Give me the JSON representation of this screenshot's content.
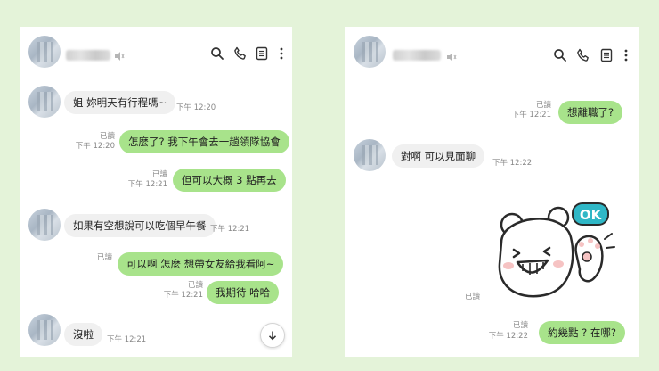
{
  "left_chat": {
    "messages": [
      {
        "text": "姐 妳明天有行程嗎~",
        "time": "下午 12:20"
      },
      {
        "text": "怎麼了? 我下午會去一趟領隊協會",
        "read": "已讀",
        "time": "下午 12:20"
      },
      {
        "text": "但可以大概 3 點再去",
        "read": "已讀",
        "time": "下午 12:21"
      },
      {
        "text": "如果有空想說可以吃個早午餐",
        "time": "下午 12:21"
      },
      {
        "text": "可以啊  怎麼  想帶女友給我看阿~",
        "read": "已讀"
      },
      {
        "text": "我期待  哈哈",
        "read": "已讀",
        "time": "下午 12:21"
      },
      {
        "text": "沒啦",
        "time": "下午 12:21"
      }
    ]
  },
  "right_chat": {
    "messages": [
      {
        "text": "想離職了?",
        "read": "已讀",
        "time": "下午 12:21"
      },
      {
        "text": "對啊 可以見面聊",
        "time": "下午 12:22"
      },
      {
        "sticker_label": "OK",
        "read": "已讀"
      },
      {
        "text": "約幾點 ? 在哪?",
        "read": "已讀",
        "time": "下午 12:22"
      }
    ]
  },
  "icons": {
    "header": [
      "search-icon",
      "phone-icon",
      "notes-icon",
      "more-icon"
    ],
    "mute": "speaker-muted-icon",
    "scroll": "arrow-down-icon"
  },
  "colors": {
    "background": "#e4f3d9",
    "outgoing_bubble": "#a8e38b",
    "incoming_bubble": "#f0f0f0",
    "sticker_ok_badge": "#2fb7c6"
  }
}
